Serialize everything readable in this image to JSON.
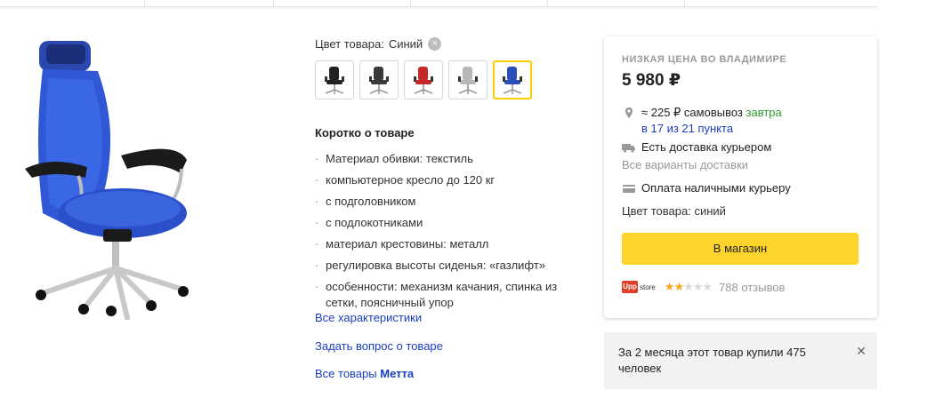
{
  "product": {
    "color_label": "Цвет товара:",
    "color_value": "Синий",
    "swatches": [
      {
        "color": "#222222"
      },
      {
        "color": "#3a3a3a"
      },
      {
        "color": "#c62828"
      },
      {
        "color": "#b7b7b7"
      },
      {
        "color": "#2b4fb8"
      }
    ],
    "short_title": "Коротко о товаре",
    "specs": [
      "Материал обивки:  текстиль",
      "компьютерное кресло до 120 кг",
      "с подголовником",
      "с подлокотниками",
      "материал крестовины: металл",
      "регулировка высоты сиденья: «газлифт»",
      "особенности: механизм качания, спинка из сетки, поясничный упор"
    ],
    "all_specs_link": "Все характеристики",
    "ask_link": "Задать вопрос о товаре",
    "all_goods_prefix": "Все товары",
    "brand": "Метта"
  },
  "offer": {
    "low_price_label": "НИЗКАЯ ЦЕНА ВО ВЛАДИМИРЕ",
    "price": "5 980 ₽",
    "pickup_text": "≈ 225 ₽ самовывоз",
    "pickup_when": "завтра",
    "pickup_points": "в 17 из 21 пункта",
    "courier": "Есть доставка курьером",
    "all_delivery": "Все варианты доставки",
    "payment": "Оплата наличными курьеру",
    "color_line": "Цвет товара:  синий",
    "shop_button": "В магазин",
    "shop_logo_mark": "Upp",
    "shop_logo_text": "store",
    "rating": 2,
    "rating_max": 5,
    "reviews": "788 отзывов"
  },
  "notice": {
    "text": "За 2 месяца этот товар купили 475 человек"
  },
  "icons": {
    "clear": "×",
    "close": "✕"
  },
  "colors": {
    "accent_yellow": "#fed42b",
    "link_blue": "#1a3dc1",
    "green": "#2d9b2d"
  }
}
